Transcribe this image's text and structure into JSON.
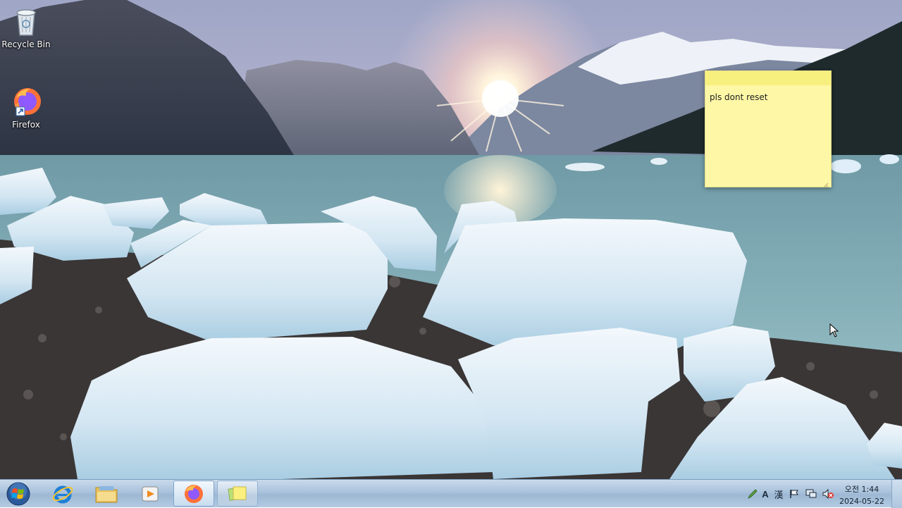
{
  "desktop": {
    "icons": [
      {
        "label": "Recycle Bin",
        "icon": "recycle-bin-icon"
      },
      {
        "label": "Firefox",
        "icon": "firefox-icon"
      }
    ],
    "wallpaper": "glacier-lake-sunset"
  },
  "sticky_note": {
    "text": "pls dont reset",
    "color": "#fdf7a6"
  },
  "taskbar": {
    "start_button": "windows-start-orb",
    "pinned": [
      {
        "name": "Internet Explorer",
        "icon": "internet-explorer-icon"
      },
      {
        "name": "Windows Explorer",
        "icon": "folder-icon"
      },
      {
        "name": "Media Player",
        "icon": "media-player-icon"
      },
      {
        "name": "Firefox",
        "icon": "firefox-icon",
        "running": true
      },
      {
        "name": "Sticky Notes",
        "icon": "sticky-notes-icon",
        "running": true
      }
    ],
    "tray": {
      "ime_mode": "A",
      "ime_hanja": "漢",
      "time": "오전 1:44",
      "date": "2024-05-22"
    }
  },
  "colors": {
    "taskbar_top": "#c9dbec",
    "taskbar_bottom": "#9db8d4",
    "sticky": "#fdf7a6"
  }
}
